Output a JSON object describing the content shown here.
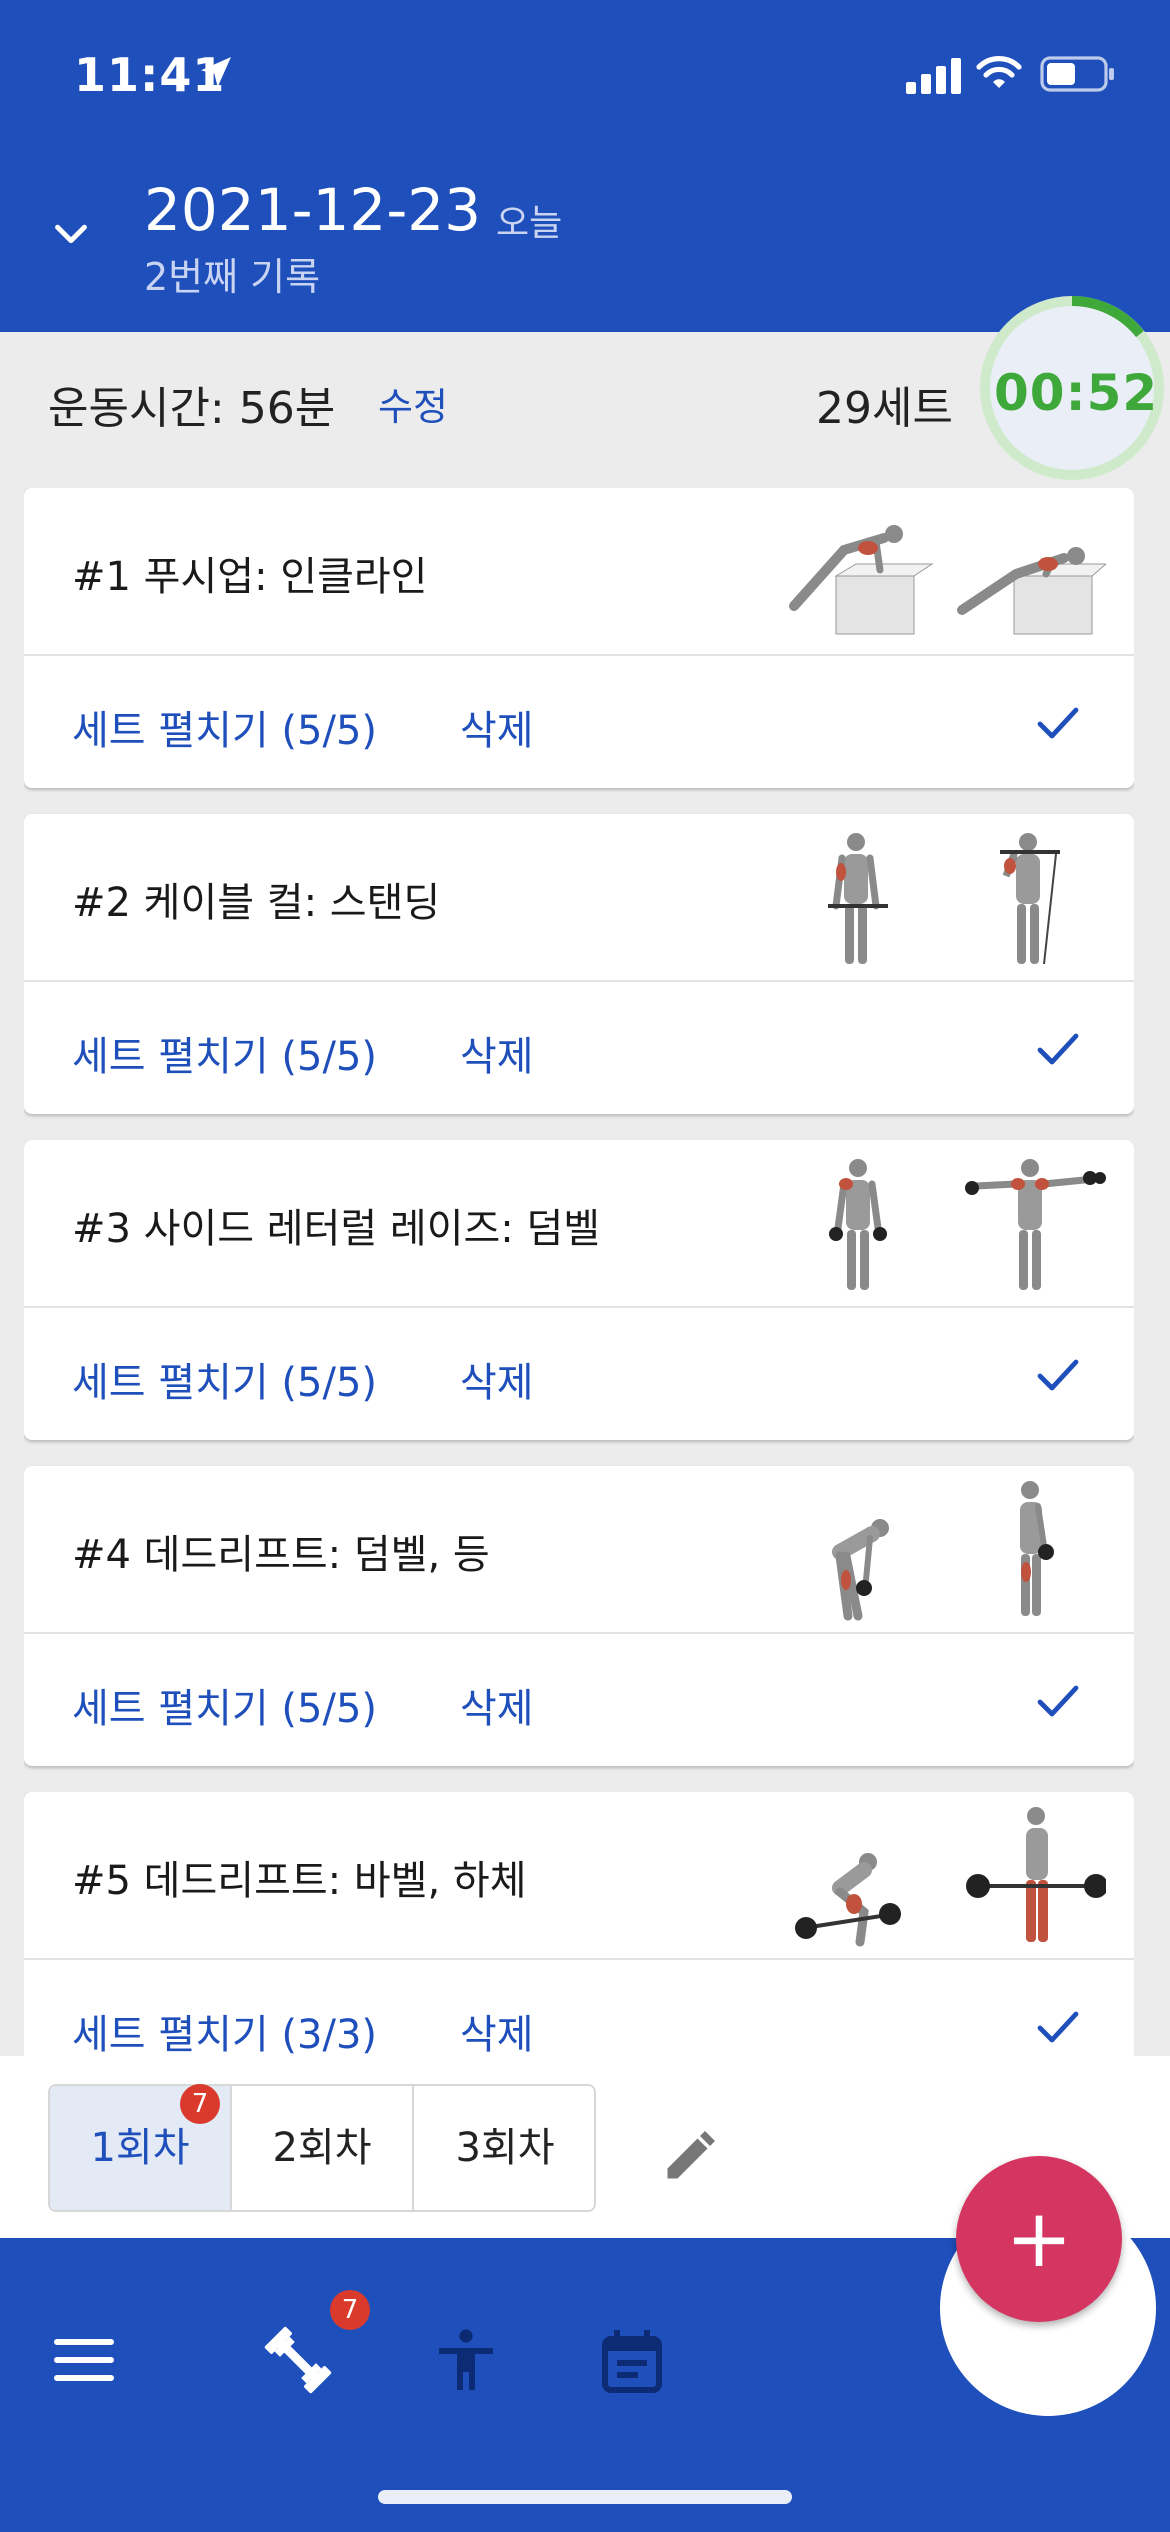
{
  "status": {
    "time": "11:41"
  },
  "header": {
    "date": "2021-12-23",
    "today_label": "오늘",
    "subtitle": "2번째 기록"
  },
  "summary": {
    "duration_label": "운동시간: 56분",
    "edit_label": "수정",
    "sets_label": "29세트",
    "timer": "00:52"
  },
  "exercises": [
    {
      "name": "#1 푸시업: 인클라인",
      "expand_label": "세트 펼치기 (5/5)",
      "delete_label": "삭제"
    },
    {
      "name": "#2 케이블 컬: 스탠딩",
      "expand_label": "세트 펼치기 (5/5)",
      "delete_label": "삭제"
    },
    {
      "name": "#3 사이드 레터럴 레이즈: 덤벨",
      "expand_label": "세트 펼치기 (5/5)",
      "delete_label": "삭제"
    },
    {
      "name": "#4 데드리프트: 덤벨, 등",
      "expand_label": "세트 펼치기 (5/5)",
      "delete_label": "삭제"
    },
    {
      "name": "#5 데드리프트: 바벨, 하체",
      "expand_label": "세트 펼치기 (3/3)",
      "delete_label": "삭제"
    }
  ],
  "sessions": {
    "tabs": [
      "1회차",
      "2회차",
      "3회차"
    ],
    "badge": "7"
  },
  "nav": {
    "workout_badge": "7",
    "fab_label": "+"
  },
  "colors": {
    "primary": "#1f4fbb",
    "fab": "#d43661",
    "timer": "#3fa83a",
    "badge": "#d93a2b"
  }
}
